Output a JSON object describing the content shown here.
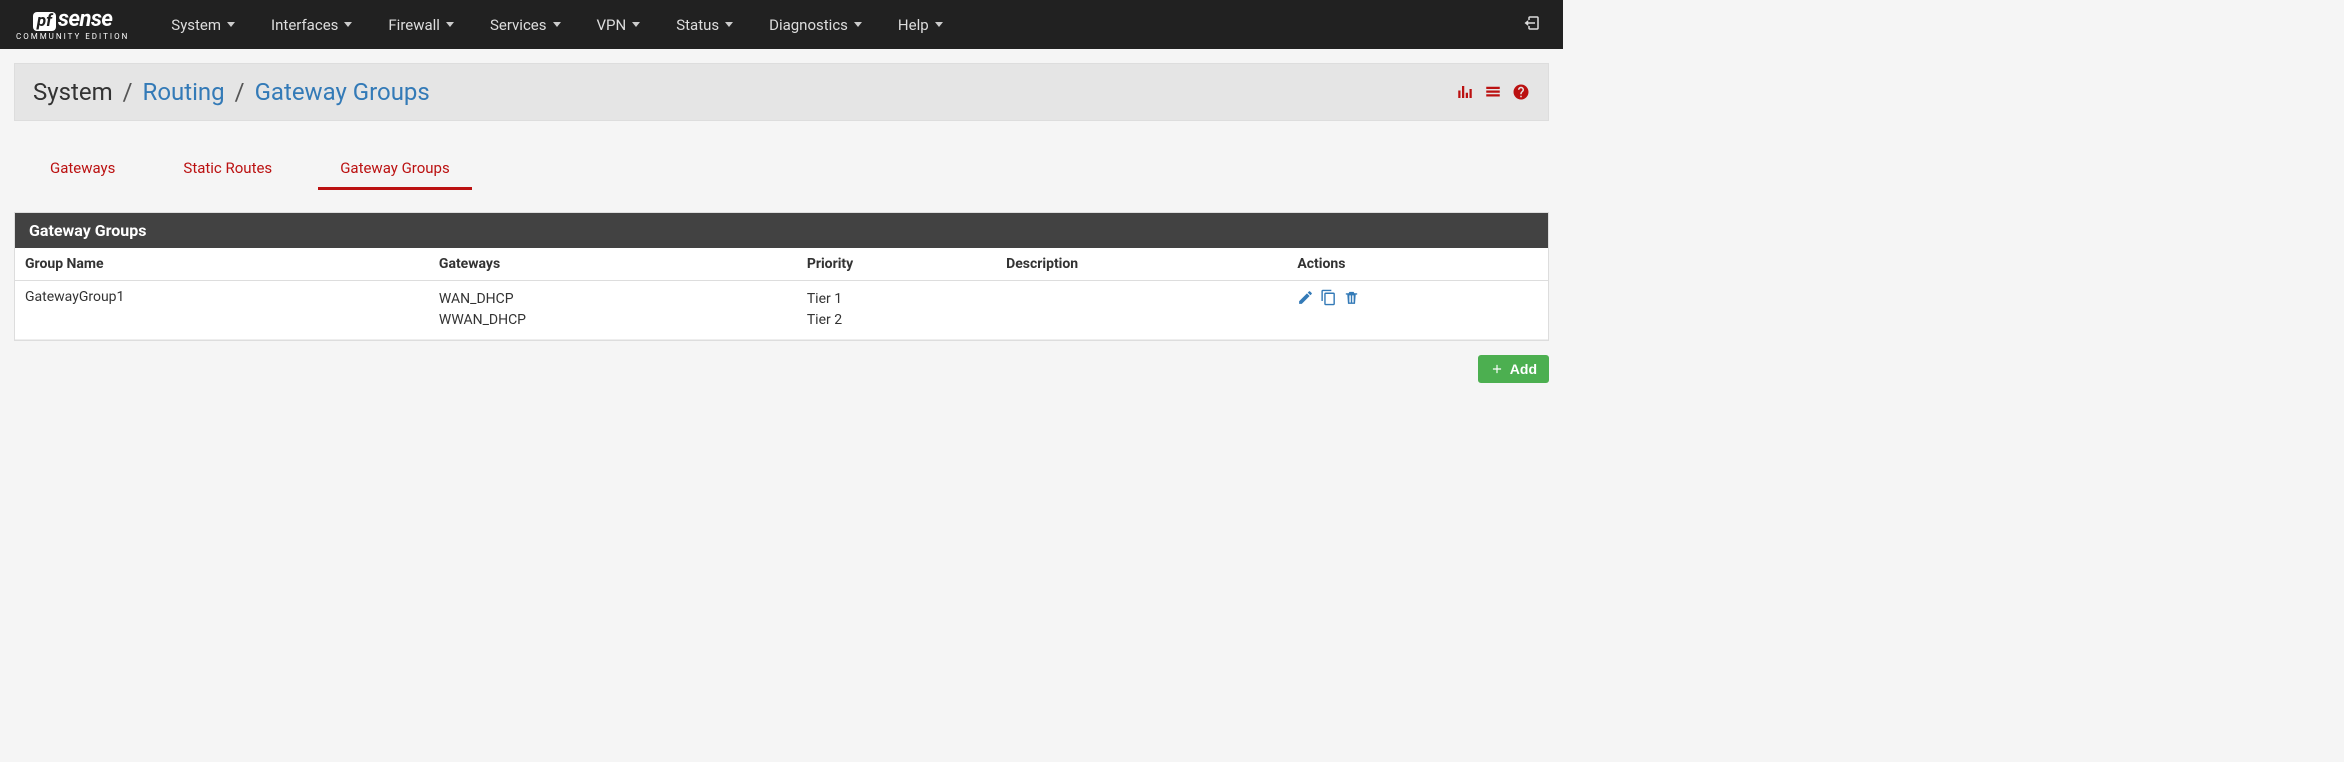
{
  "logo": {
    "pf": "pf",
    "sense": "sense",
    "edition": "COMMUNITY EDITION"
  },
  "nav": [
    {
      "label": "System"
    },
    {
      "label": "Interfaces"
    },
    {
      "label": "Firewall"
    },
    {
      "label": "Services"
    },
    {
      "label": "VPN"
    },
    {
      "label": "Status"
    },
    {
      "label": "Diagnostics"
    },
    {
      "label": "Help"
    }
  ],
  "breadcrumb": {
    "root": "System",
    "mid": "Routing",
    "leaf": "Gateway Groups"
  },
  "tabs": [
    {
      "label": "Gateways"
    },
    {
      "label": "Static Routes"
    },
    {
      "label": "Gateway Groups"
    }
  ],
  "panel": {
    "title": "Gateway Groups"
  },
  "columns": {
    "name": "Group Name",
    "gateways": "Gateways",
    "priority": "Priority",
    "description": "Description",
    "actions": "Actions"
  },
  "rows": [
    {
      "name": "GatewayGroup1",
      "gateways": [
        "WAN_DHCP",
        "WWAN_DHCP"
      ],
      "priorities": [
        "Tier 1",
        "Tier 2"
      ],
      "description": ""
    }
  ],
  "add_label": "Add"
}
